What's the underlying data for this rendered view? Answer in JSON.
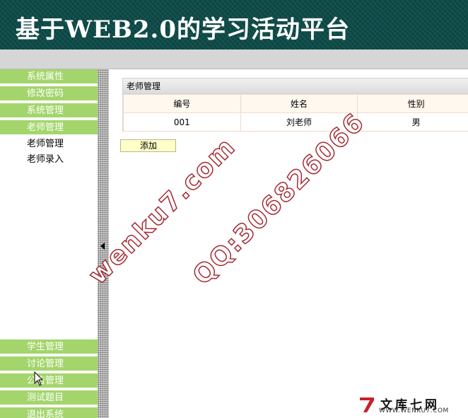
{
  "header": {
    "title": "基于WEB2.0的学习活动平台",
    "background": "#0d4b48"
  },
  "sidebar": {
    "accent": "#a3d56c",
    "top_items": [
      {
        "label": "系统属性"
      },
      {
        "label": "修改密码"
      },
      {
        "label": "系统管理"
      },
      {
        "label": "老师管理"
      }
    ],
    "sub_items": [
      {
        "label": "老师管理"
      },
      {
        "label": "老师录入"
      }
    ],
    "bottom_items": [
      {
        "label": "学生管理"
      },
      {
        "label": "讨论管理"
      },
      {
        "label": "公告管理"
      },
      {
        "label": "测试题目"
      },
      {
        "label": "退出系统"
      }
    ]
  },
  "splitter": {
    "icon": "chevron-left-icon"
  },
  "main": {
    "panel_title": "老师管理",
    "columns": [
      "编号",
      "姓名",
      "性别"
    ],
    "rows": [
      [
        "001",
        "刘老师",
        "男"
      ]
    ],
    "add_button": "添加"
  },
  "watermarks": {
    "site": "wenku7.com",
    "qq": "QQ:306826066",
    "color": "#a52a33"
  },
  "logo": {
    "cn": "文库七网",
    "en": "WWW.WENKU7.COM",
    "icon": "wenku7-logo-icon"
  },
  "cursor": {
    "icon": "mouse-pointer-icon"
  }
}
